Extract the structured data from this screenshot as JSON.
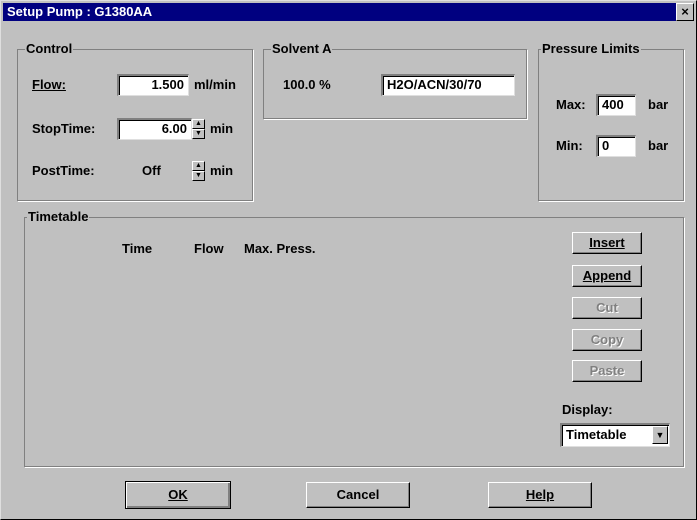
{
  "window": {
    "title": "Setup Pump : G1380AA",
    "close_glyph": "×"
  },
  "control": {
    "legend": "Control",
    "flow_label": "Flow:",
    "flow_value": "1.500",
    "flow_unit": "ml/min",
    "stoptime_label": "StopTime:",
    "stoptime_value": "6.00",
    "stoptime_unit": "min",
    "posttime_label": "PostTime:",
    "posttime_value": "Off",
    "posttime_unit": "min"
  },
  "solvent": {
    "legend": "Solvent A",
    "percent": "100.0 %",
    "name": "H2O/ACN/30/70"
  },
  "pressure": {
    "legend": "Pressure Limits",
    "max_label": "Max:",
    "max_value": "400",
    "min_label": "Min:",
    "min_value": "0",
    "unit": "bar"
  },
  "timetable": {
    "legend": "Timetable",
    "columns": [
      "Time",
      "Flow",
      "Max. Press."
    ],
    "buttons": {
      "insert": "Insert",
      "append": "Append",
      "cut": "Cut",
      "copy": "Copy",
      "paste": "Paste"
    },
    "display_label": "Display:",
    "display_value": "Timetable"
  },
  "footer": {
    "ok": "OK",
    "cancel": "Cancel",
    "help": "Help"
  }
}
